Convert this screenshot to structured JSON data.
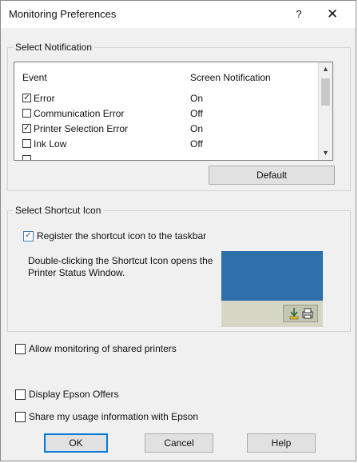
{
  "window": {
    "title": "Monitoring Preferences",
    "help_label": "?",
    "close_label": "✕"
  },
  "notification": {
    "group_label": "Select Notification",
    "columns": {
      "event": "Event",
      "screen": "Screen Notification"
    },
    "rows": [
      {
        "checked": true,
        "event": "Error",
        "value": "On"
      },
      {
        "checked": false,
        "event": "Communication Error",
        "value": "Off"
      },
      {
        "checked": true,
        "event": "Printer Selection Error",
        "value": "On"
      },
      {
        "checked": false,
        "event": "Ink Low",
        "value": "Off"
      }
    ],
    "default_label": "Default"
  },
  "shortcut": {
    "group_label": "Select Shortcut Icon",
    "register_label": "Register the shortcut icon to the taskbar",
    "register_checked": true,
    "description": "Double-clicking the Shortcut Icon opens the Printer Status Window.",
    "preview_colors": {
      "screen": "#2f6faa",
      "taskbar": "#d5d6c4"
    }
  },
  "options": {
    "allow_shared_label": "Allow monitoring of shared printers",
    "allow_shared_checked": false,
    "epson_offers_label": "Display Epson Offers",
    "epson_offers_checked": false,
    "share_usage_label": "Share my usage information with Epson",
    "share_usage_checked": false
  },
  "footer": {
    "ok_label": "OK",
    "cancel_label": "Cancel",
    "help_label": "Help"
  },
  "colors": {
    "accent": "#0078d7",
    "check_blue": "#3c7fb1"
  }
}
